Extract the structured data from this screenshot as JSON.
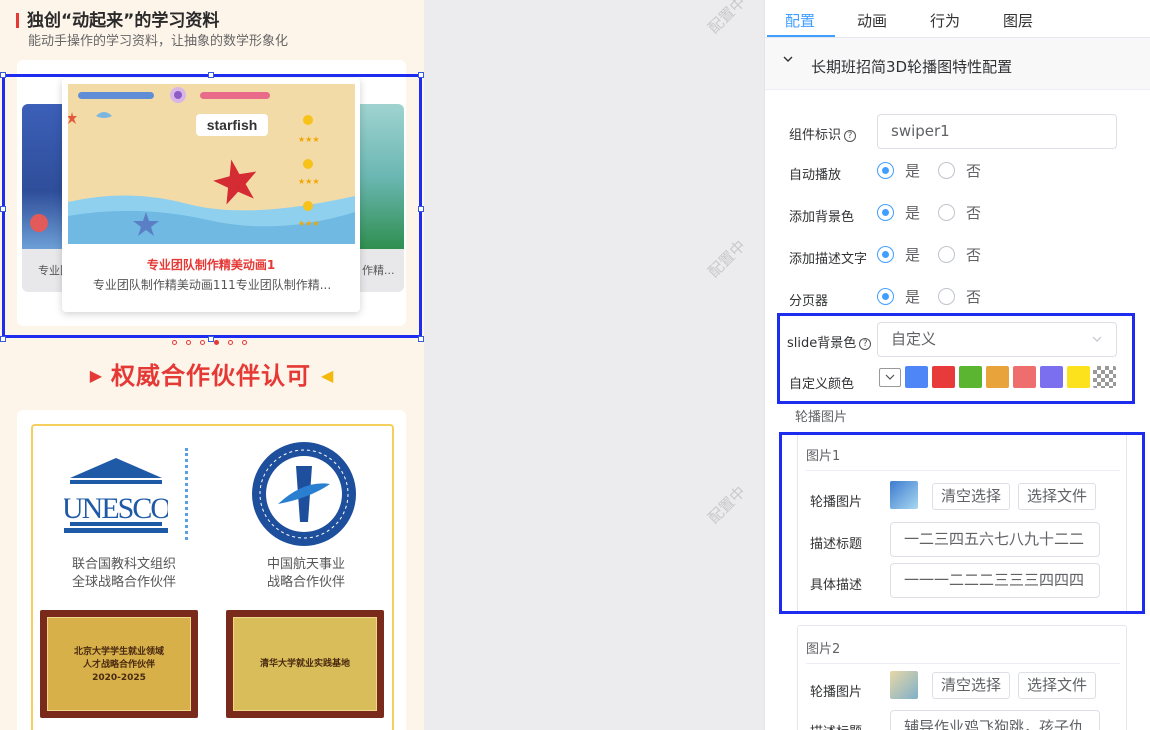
{
  "preview": {
    "section_title": "独创“动起来”的学习资料",
    "section_subtitle": "能动手操作的学习资料，让抽象的数学形象化",
    "carousel": {
      "main_title": "专业团队制作精美动画1",
      "main_desc": "专业团队制作精美动画111专业团队制作精...",
      "left_caption": "专业团",
      "right_caption": "作精...",
      "scene_word": "starfish",
      "dot_count": 6,
      "active_dot": 3
    },
    "partner_title": "权威合作伙伴认可",
    "partners": [
      {
        "logo": "UNESCO",
        "line1": "联合国教科文组织",
        "line2": "全球战略合作伙伴"
      },
      {
        "logo": "CASC",
        "line1": "中国航天事业",
        "line2": "战略合作伙伴"
      }
    ],
    "plaques": [
      {
        "line1": "北京大学学生就业领域",
        "line2": "人才战略合作伙伴",
        "line3": "2020-2025"
      },
      {
        "line1": "清华大学就业实践基地"
      }
    ]
  },
  "watermark": "配置中",
  "panel": {
    "tabs": [
      "配置",
      "动画",
      "行为",
      "图层"
    ],
    "active_tab": 0,
    "collapse_title": "长期班招简3D轮播图特性配置",
    "component_id_label": "组件标识",
    "component_id_value": "swiper1",
    "yes": "是",
    "no": "否",
    "radio_rows": [
      {
        "label": "自动播放",
        "value": true
      },
      {
        "label": "添加背景色",
        "value": true
      },
      {
        "label": "添加描述文字",
        "value": true
      },
      {
        "label": "分页器",
        "value": true
      }
    ],
    "slide_bg_label": "slide背景色",
    "slide_bg_value": "自定义",
    "custom_color_label": "自定义颜色",
    "swatches": [
      "#4f86f7",
      "#e83a3a",
      "#5cb531",
      "#e8a43a",
      "#ee6d6d",
      "#7b6ff0",
      "#fbe21c"
    ],
    "images_label": "轮播图片",
    "images": [
      {
        "header": "图片1",
        "image_label": "轮播图片",
        "clear": "清空选择",
        "choose": "选择文件",
        "title_label": "描述标题",
        "title_value": "一二三四五六七八九十二二",
        "desc_label": "具体描述",
        "desc_value": "一一一二二二三三三四四四"
      },
      {
        "header": "图片2",
        "image_label": "轮播图片",
        "clear": "清空选择",
        "choose": "选择文件",
        "title_label": "描述标题",
        "title_value": "辅导作业鸡飞狗跳，孩子仇"
      }
    ]
  }
}
